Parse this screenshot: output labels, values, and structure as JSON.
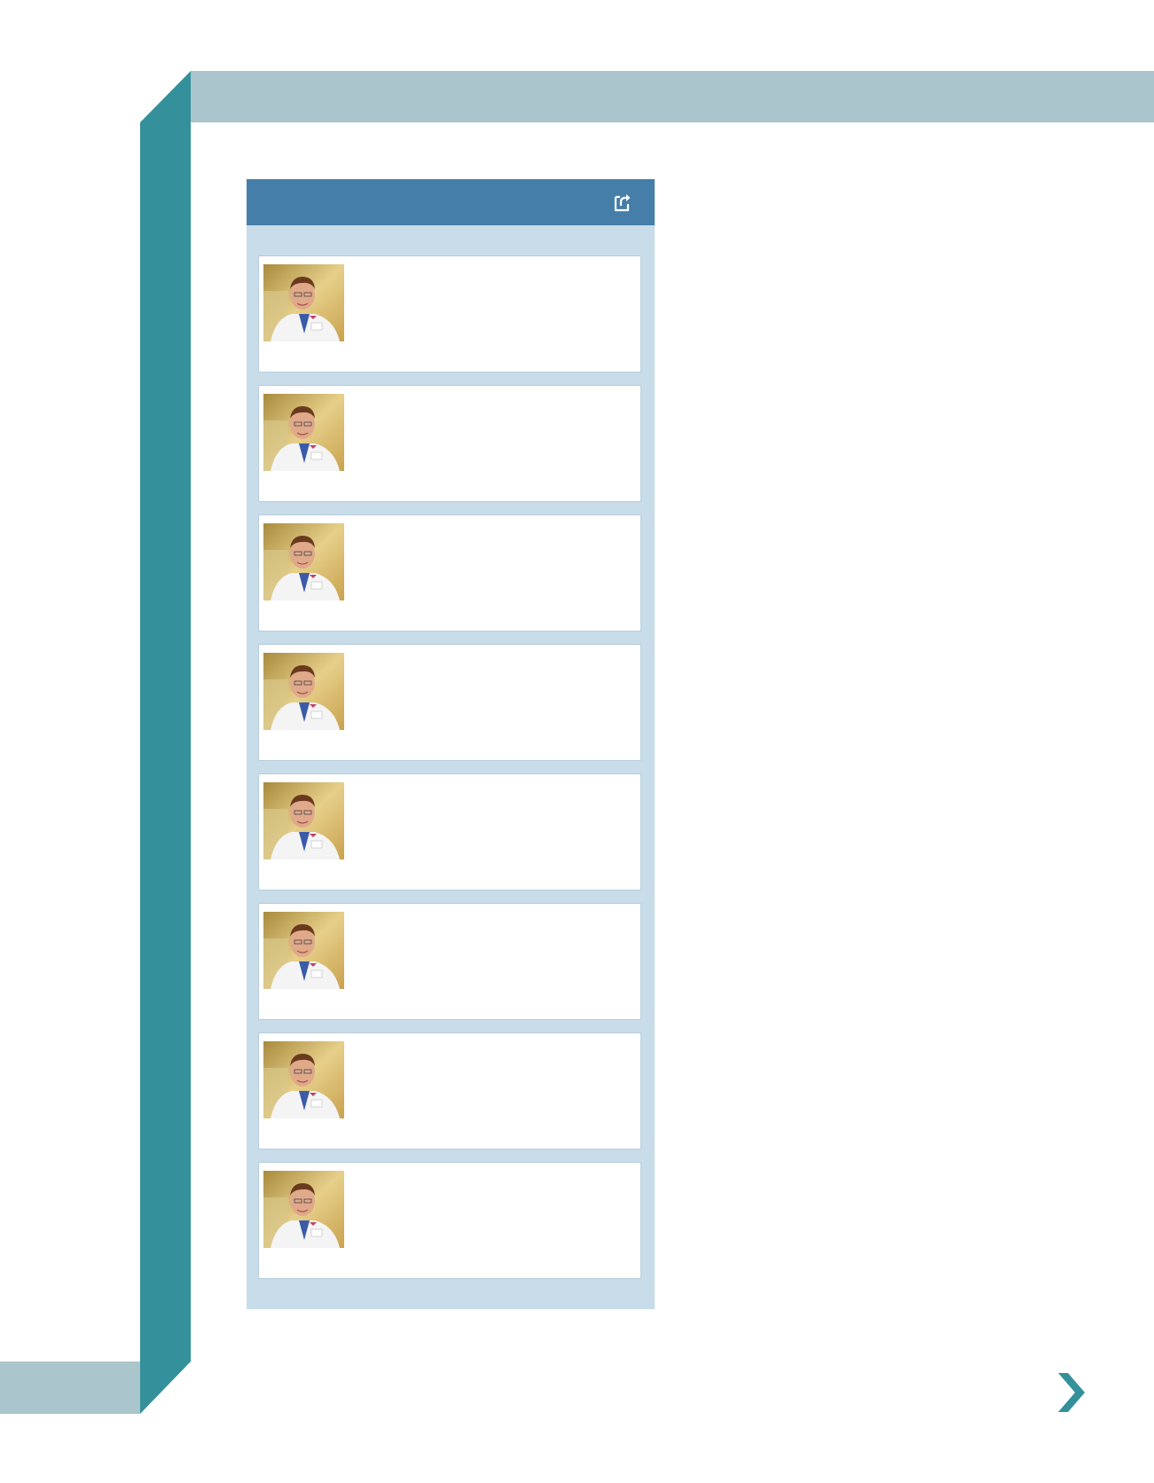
{
  "theme": {
    "top_band_color": "#aac5cc",
    "left_bar_color": "#34909a",
    "panel_header_color": "#457ea9",
    "panel_body_color": "#c8dcea",
    "arrow_color": "#34909a"
  },
  "panel": {
    "title": "",
    "external_link_icon": "external-link-icon",
    "cards": [
      {
        "avatar_icon": "doctor-portrait-photo",
        "text": ""
      },
      {
        "avatar_icon": "doctor-portrait-photo",
        "text": ""
      },
      {
        "avatar_icon": "doctor-portrait-photo",
        "text": ""
      },
      {
        "avatar_icon": "doctor-portrait-photo",
        "text": ""
      },
      {
        "avatar_icon": "doctor-portrait-photo",
        "text": ""
      },
      {
        "avatar_icon": "doctor-portrait-photo",
        "text": ""
      },
      {
        "avatar_icon": "doctor-portrait-photo",
        "text": ""
      },
      {
        "avatar_icon": "doctor-portrait-photo",
        "text": ""
      }
    ]
  },
  "navigation": {
    "next_icon": "chevron-right-icon"
  }
}
